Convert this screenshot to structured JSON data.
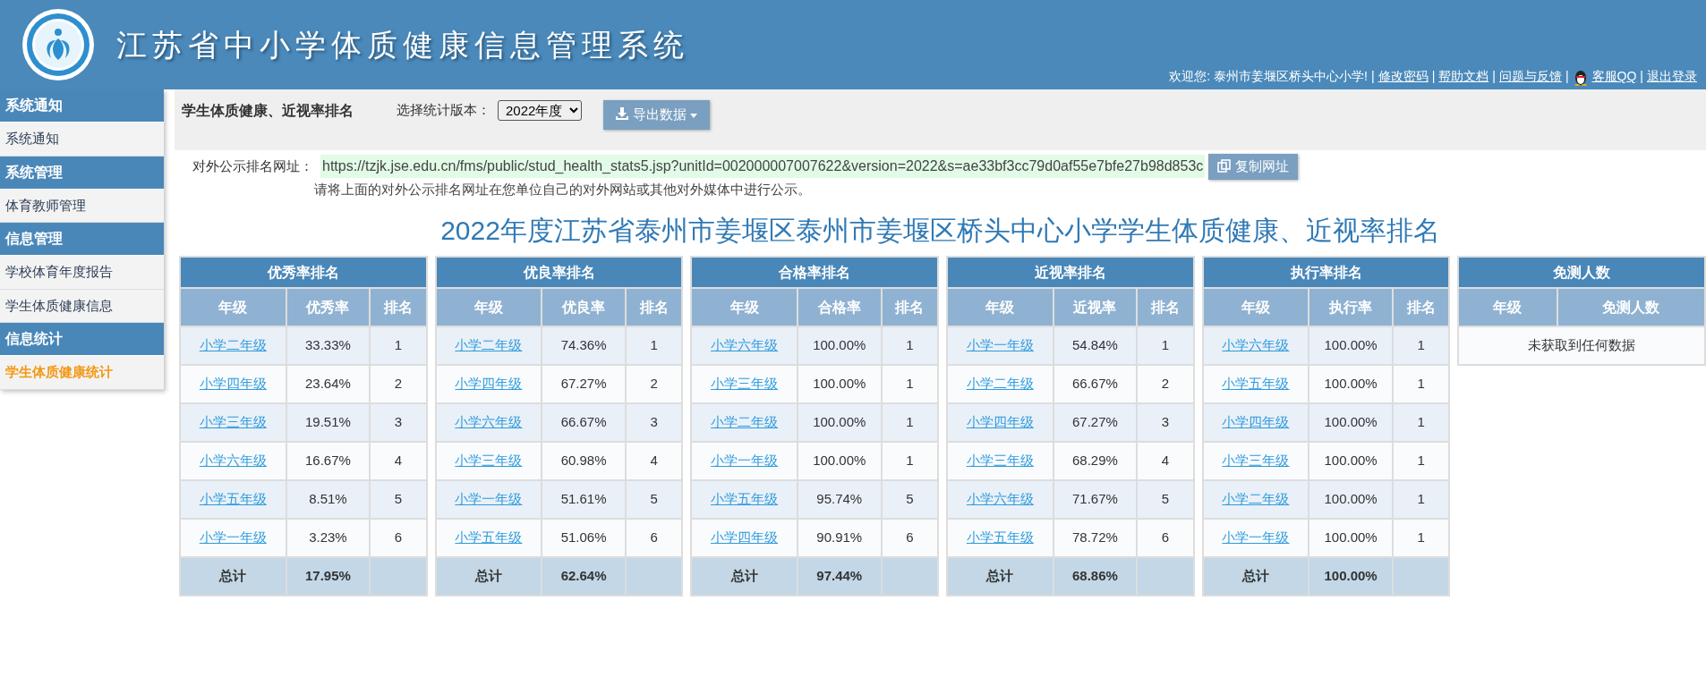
{
  "header": {
    "title": "江苏省中小学体质健康信息管理系统"
  },
  "user_bar": [
    {
      "kind": "text",
      "text": "欢迎您: 泰州市姜堰区桥头中心小学!"
    },
    {
      "kind": "separator",
      "text": "|"
    },
    {
      "kind": "link",
      "text": "修改密码"
    },
    {
      "kind": "separator",
      "text": "|"
    },
    {
      "kind": "link",
      "text": "帮助文档"
    },
    {
      "kind": "separator",
      "text": "|"
    },
    {
      "kind": "link",
      "text": "问题与反馈"
    },
    {
      "kind": "separator",
      "text": "|"
    },
    {
      "kind": "qq_link",
      "text": "客服QQ"
    },
    {
      "kind": "separator",
      "text": "|"
    },
    {
      "kind": "link",
      "text": "退出登录"
    }
  ],
  "sidebar": [
    {
      "title": "系统通知",
      "items": [
        {
          "label": "系统通知",
          "selected": false
        }
      ]
    },
    {
      "title": "系统管理",
      "items": [
        {
          "label": "体育教师管理",
          "selected": false
        }
      ]
    },
    {
      "title": "信息管理",
      "items": [
        {
          "label": "学校体育年度报告",
          "selected": false
        },
        {
          "label": "学生体质健康信息",
          "selected": false
        }
      ]
    },
    {
      "title": "信息统计",
      "items": [
        {
          "label": "学生体质健康统计",
          "selected": true
        }
      ]
    }
  ],
  "toolbar": {
    "title": "学生体质健康、近视率排名",
    "version_label": "选择统计版本：",
    "version_value": "2022年度",
    "export_button": "导出数据"
  },
  "public_url": {
    "label": "对外公示排名网址：",
    "url": "https://tzjk.jse.edu.cn/fms/public/stud_health_stats5.jsp?unitId=002000007007622&version=2022&s=ae33bf3cc79d0af55e7bfe27b98d853c",
    "copy_button": "复制网址",
    "hint": "请将上面的对外公示排名网址在您单位自己的对外网站或其他对外媒体中进行公示。"
  },
  "report_title": "2022年度江苏省泰州市姜堰区泰州市姜堰区桥头中心小学学生体质健康、近视率排名",
  "tables": [
    {
      "title": "优秀率排名",
      "columns": [
        "年级",
        "优秀率",
        "排名"
      ],
      "rows": [
        [
          "小学二年级",
          "33.33%",
          "1"
        ],
        [
          "小学四年级",
          "23.64%",
          "2"
        ],
        [
          "小学三年级",
          "19.51%",
          "3"
        ],
        [
          "小学六年级",
          "16.67%",
          "4"
        ],
        [
          "小学五年级",
          "8.51%",
          "5"
        ],
        [
          "小学一年级",
          "3.23%",
          "6"
        ]
      ],
      "total": [
        "总计",
        "17.95%"
      ]
    },
    {
      "title": "优良率排名",
      "columns": [
        "年级",
        "优良率",
        "排名"
      ],
      "rows": [
        [
          "小学二年级",
          "74.36%",
          "1"
        ],
        [
          "小学四年级",
          "67.27%",
          "2"
        ],
        [
          "小学六年级",
          "66.67%",
          "3"
        ],
        [
          "小学三年级",
          "60.98%",
          "4"
        ],
        [
          "小学一年级",
          "51.61%",
          "5"
        ],
        [
          "小学五年级",
          "51.06%",
          "6"
        ]
      ],
      "total": [
        "总计",
        "62.64%"
      ]
    },
    {
      "title": "合格率排名",
      "columns": [
        "年级",
        "合格率",
        "排名"
      ],
      "rows": [
        [
          "小学六年级",
          "100.00%",
          "1"
        ],
        [
          "小学三年级",
          "100.00%",
          "1"
        ],
        [
          "小学二年级",
          "100.00%",
          "1"
        ],
        [
          "小学一年级",
          "100.00%",
          "1"
        ],
        [
          "小学五年级",
          "95.74%",
          "5"
        ],
        [
          "小学四年级",
          "90.91%",
          "6"
        ]
      ],
      "total": [
        "总计",
        "97.44%"
      ]
    },
    {
      "title": "近视率排名",
      "columns": [
        "年级",
        "近视率",
        "排名"
      ],
      "rows": [
        [
          "小学一年级",
          "54.84%",
          "1"
        ],
        [
          "小学二年级",
          "66.67%",
          "2"
        ],
        [
          "小学四年级",
          "67.27%",
          "3"
        ],
        [
          "小学三年级",
          "68.29%",
          "4"
        ],
        [
          "小学六年级",
          "71.67%",
          "5"
        ],
        [
          "小学五年级",
          "78.72%",
          "6"
        ]
      ],
      "total": [
        "总计",
        "68.86%"
      ]
    },
    {
      "title": "执行率排名",
      "columns": [
        "年级",
        "执行率",
        "排名"
      ],
      "rows": [
        [
          "小学六年级",
          "100.00%",
          "1"
        ],
        [
          "小学五年级",
          "100.00%",
          "1"
        ],
        [
          "小学四年级",
          "100.00%",
          "1"
        ],
        [
          "小学三年级",
          "100.00%",
          "1"
        ],
        [
          "小学二年级",
          "100.00%",
          "1"
        ],
        [
          "小学一年级",
          "100.00%",
          "1"
        ]
      ],
      "total": [
        "总计",
        "100.00%"
      ]
    },
    {
      "title": "免测人数",
      "columns": [
        "年级",
        "免测人数"
      ],
      "empty_message": "未获取到任何数据"
    }
  ]
}
